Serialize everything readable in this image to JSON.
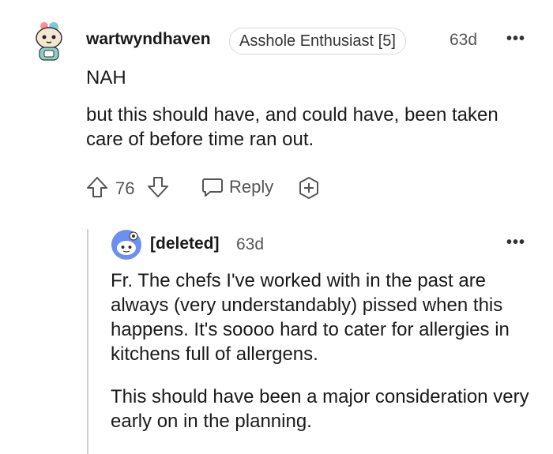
{
  "comment": {
    "username": "wartwyndhaven",
    "flair": "Asshole Enthusiast [5]",
    "age": "63d",
    "verdict": "NAH",
    "body": "but this should have, and could have, been taken care of before time ran out.",
    "votes": "76",
    "reply_label": "Reply",
    "more_label": "•••"
  },
  "reply": {
    "username": "[deleted]",
    "age": "63d",
    "paragraphs": [
      "Fr. The chefs I've worked with in the past are always (very understandably) pissed when this happens. It's soooo hard to cater for allergies in kitchens full of allergens.",
      "This should have been a major consideration very early on in the planning."
    ],
    "more_label": "•••"
  },
  "colors": {
    "text": "#1a1a1b",
    "muted": "#555555",
    "border": "#d7dadc",
    "thread": "#d0d3d6"
  },
  "icons": [
    "cat-avatar-icon",
    "upvote-icon",
    "downvote-icon",
    "reply-icon",
    "award-icon",
    "snoo-avatar-icon",
    "more-icon"
  ]
}
